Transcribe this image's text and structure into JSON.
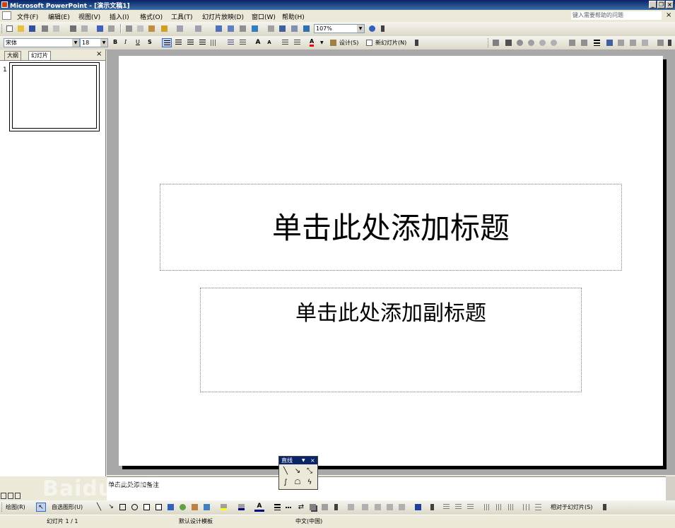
{
  "window": {
    "title": "Microsoft PowerPoint - [演示文稿1]"
  },
  "menubar": {
    "items": [
      "文件(F)",
      "编辑(E)",
      "视图(V)",
      "插入(I)",
      "格式(O)",
      "工具(T)",
      "幻灯片放映(D)",
      "窗口(W)",
      "帮助(H)"
    ],
    "help_placeholder": "键入需要帮助的问题"
  },
  "standard_toolbar": {
    "zoom": "107%"
  },
  "formatting_toolbar": {
    "font": "宋体",
    "size": "18",
    "bold": "B",
    "italic": "I",
    "underline": "U",
    "shadow": "S",
    "font_color_letter": "A",
    "design_label": "设计(S)",
    "new_slide_label": "新幻灯片(N)"
  },
  "left_panel": {
    "tabs": [
      "大纲",
      "幻灯片"
    ],
    "slide_numbers": [
      "1"
    ]
  },
  "slide": {
    "title_placeholder": "单击此处添加标题",
    "subtitle_placeholder": "单击此处添加副标题"
  },
  "notes": {
    "placeholder": "单击此处添加备注"
  },
  "drawing_toolbar": {
    "draw_label": "绘图(R)",
    "autoshapes_label": "自选图形(U)",
    "relative_label": "相对于幻灯片(S)"
  },
  "line_toolbar": {
    "title": "直线"
  },
  "status_bar": {
    "slide_info": "幻灯片 1 / 1",
    "template": "默认设计模板",
    "language": "中文(中国)"
  },
  "watermark": "Baidu百科",
  "colors": {
    "titlebar": "#0a246a",
    "chrome": "#ece9d8",
    "slide_bg": "#a8a8a8"
  }
}
